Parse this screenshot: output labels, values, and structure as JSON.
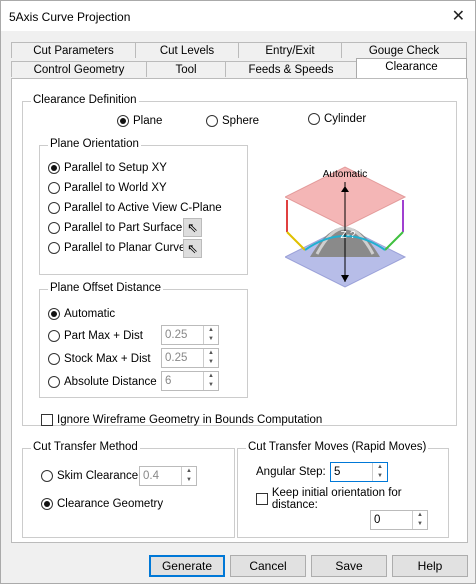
{
  "window": {
    "title": "5Axis Curve Projection",
    "close_glyph": "✕"
  },
  "tabs_back": [
    "Cut Parameters",
    "Cut Levels",
    "Entry/Exit",
    "Gouge Check"
  ],
  "tabs_front": [
    "Control Geometry",
    "Tool",
    "Feeds & Speeds",
    "Clearance"
  ],
  "active_tab": "Clearance",
  "clearance_definition": {
    "legend": "Clearance Definition",
    "options": [
      "Plane",
      "Sphere",
      "Cylinder"
    ],
    "selected": "Plane"
  },
  "plane_orientation": {
    "legend": "Plane Orientation",
    "options": [
      "Parallel to Setup XY",
      "Parallel to World XY",
      "Parallel to Active View C-Plane",
      "Parallel to Part Surface",
      "Parallel to Planar Curve"
    ],
    "selected": "Parallel to Setup XY"
  },
  "diagram": {
    "label_top": "Automatic",
    "label_mid": "Z-?"
  },
  "plane_offset": {
    "legend": "Plane Offset Distance",
    "automatic": "Automatic",
    "rows": [
      {
        "label": "Part Max + Dist",
        "value": "0.25"
      },
      {
        "label": "Stock Max + Dist",
        "value": "0.25"
      },
      {
        "label": "Absolute Distance",
        "value": "6"
      }
    ],
    "selected": "Automatic"
  },
  "ignore_wireframe": {
    "label": "Ignore Wireframe Geometry in Bounds Computation",
    "checked": false
  },
  "cut_transfer_method": {
    "legend": "Cut Transfer Method",
    "skim_label": "Skim Clearance",
    "skim_value": "0.4",
    "geometry_label": "Clearance Geometry",
    "selected": "Clearance Geometry"
  },
  "cut_transfer_moves": {
    "legend": "Cut Transfer Moves (Rapid Moves)",
    "angular_label": "Angular Step:",
    "angular_value": "5",
    "keep_label": "Keep initial orientation for distance:",
    "keep_checked": false,
    "keep_value": "0"
  },
  "buttons": {
    "generate": "Generate",
    "cancel": "Cancel",
    "save": "Save",
    "help": "Help"
  },
  "colors": {
    "plane_pink": "#f4b6b6",
    "plane_blue": "#b7bde8",
    "accent": "#0078d7"
  }
}
